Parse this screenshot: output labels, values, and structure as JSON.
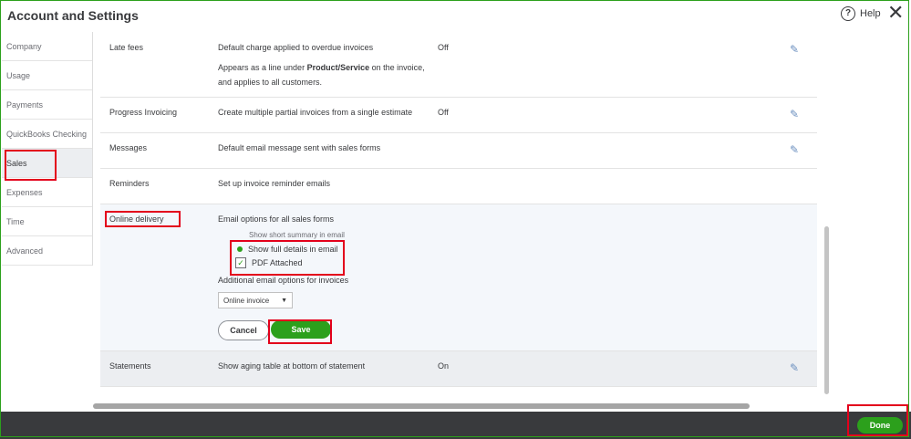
{
  "header": {
    "title": "Account and Settings",
    "help_label": "Help",
    "help_glyph": "?",
    "close_glyph": "✕"
  },
  "sidebar": {
    "items": [
      {
        "label": "Company"
      },
      {
        "label": "Usage"
      },
      {
        "label": "Payments"
      },
      {
        "label": "QuickBooks Checking"
      },
      {
        "label": "Sales"
      },
      {
        "label": "Expenses"
      },
      {
        "label": "Time"
      },
      {
        "label": "Advanced"
      }
    ]
  },
  "settings": {
    "late_fees": {
      "label": "Late fees",
      "desc": "Default charge applied to overdue invoices",
      "desc2_prefix": "Appears as a line under ",
      "desc2_bold": "Product/Service",
      "desc2_suffix": " on the invoice,",
      "desc3": "and applies to all customers.",
      "value": "Off"
    },
    "progress_invoicing": {
      "label": "Progress Invoicing",
      "desc": "Create multiple partial invoices from a single estimate",
      "value": "Off"
    },
    "messages": {
      "label": "Messages",
      "desc": "Default email message sent with sales forms"
    },
    "reminders": {
      "label": "Reminders",
      "desc": "Set up invoice reminder emails"
    },
    "online_delivery": {
      "label": "Online delivery",
      "desc": "Email options for all sales forms",
      "option_short": "Show short summary in email",
      "option_full": "Show full details in email",
      "pdf_attached": "PDF Attached",
      "additional": "Additional email options for invoices",
      "dropdown_value": "Online invoice",
      "cancel_label": "Cancel",
      "save_label": "Save"
    },
    "statements": {
      "label": "Statements",
      "desc": "Show aging table at bottom of statement",
      "value": "On"
    }
  },
  "footer": {
    "done_label": "Done"
  },
  "colors": {
    "accent": "#2ca01c",
    "highlight": "#e3001b",
    "footer": "#393a3d"
  }
}
